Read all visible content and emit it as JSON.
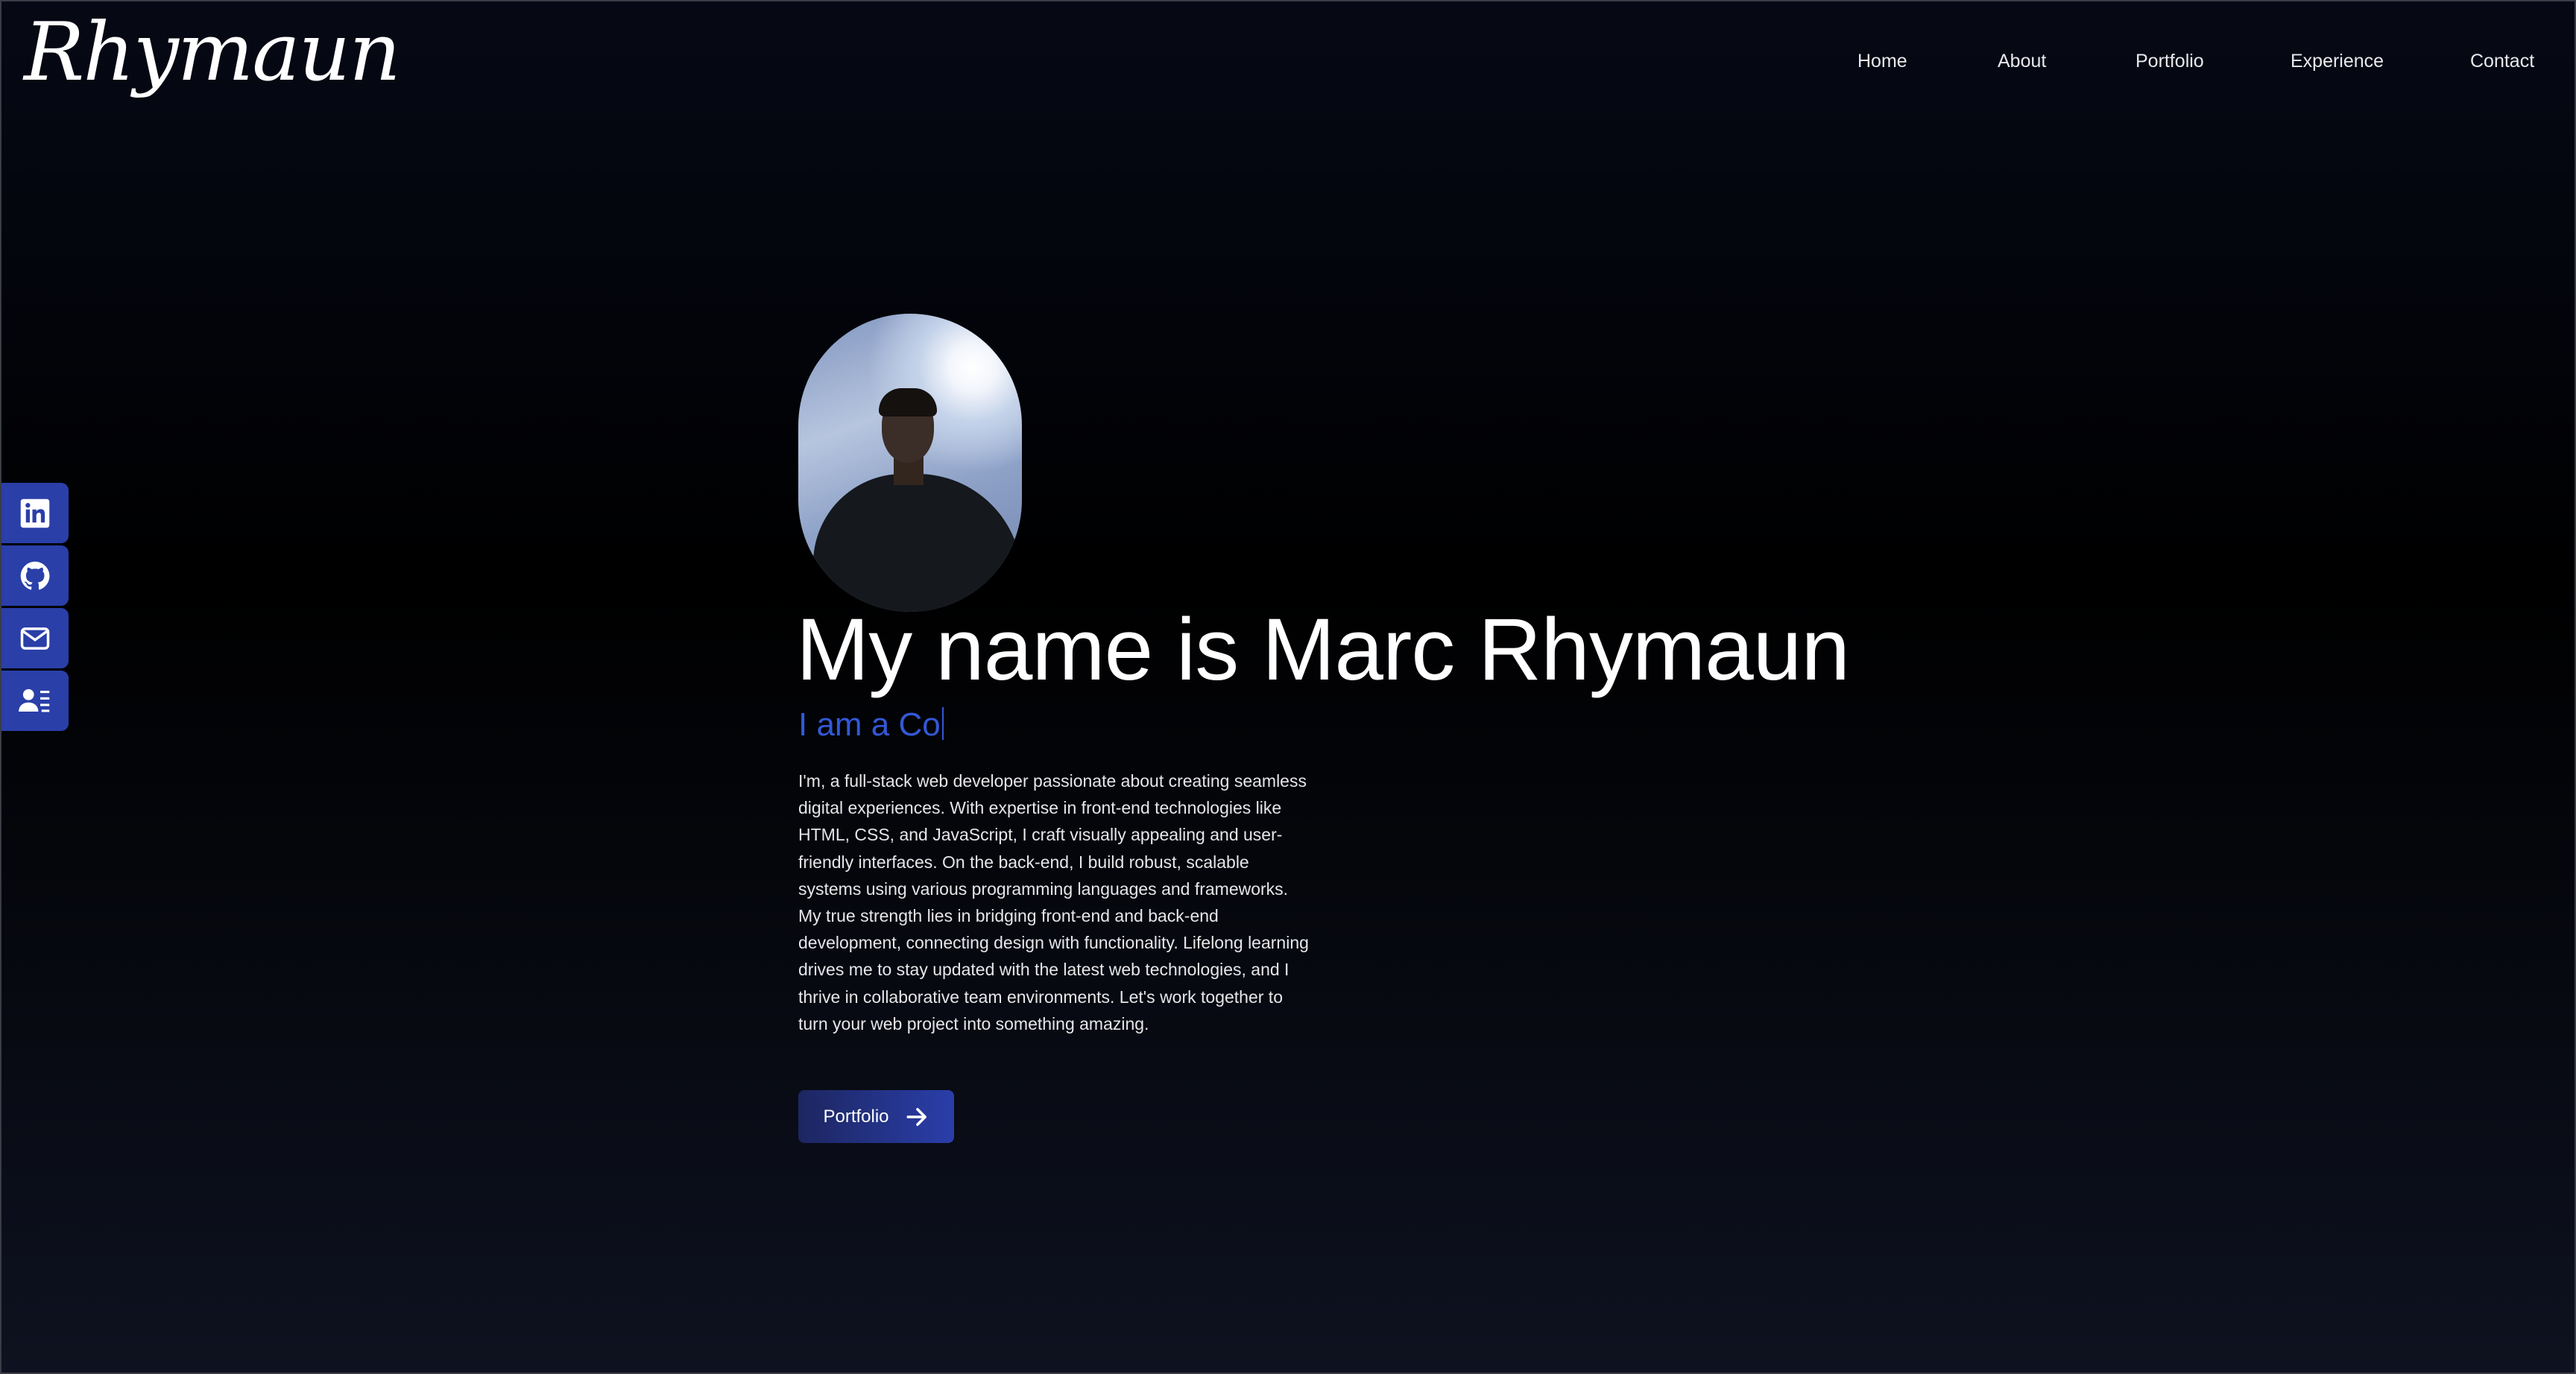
{
  "header": {
    "logo": "Rhymaun",
    "nav": [
      "Home",
      "About",
      "Portfolio",
      "Experience",
      "Contact"
    ]
  },
  "social": [
    {
      "icon": "linkedin-icon"
    },
    {
      "icon": "github-icon"
    },
    {
      "icon": "mail-icon"
    },
    {
      "icon": "contact-card-icon"
    }
  ],
  "hero": {
    "title": "My name is Marc Rhymaun",
    "typed_text": "I am a Co",
    "bio": "I'm, a full-stack web developer passionate about creating seamless digital experiences. With expertise in front-end technologies like HTML, CSS, and JavaScript, I craft visually appealing and user-friendly interfaces. On the back-end, I build robust, scalable systems using various programming languages and frameworks. My true strength lies in bridging front-end and back-end development, connecting design with functionality. Lifelong learning drives me to stay updated with the latest web technologies, and I thrive in collaborative team environments. Let's work together to turn your web project into something amazing.",
    "button_label": "Portfolio"
  },
  "colors": {
    "accent": "#2a3fa8",
    "typed": "#3358d6"
  }
}
